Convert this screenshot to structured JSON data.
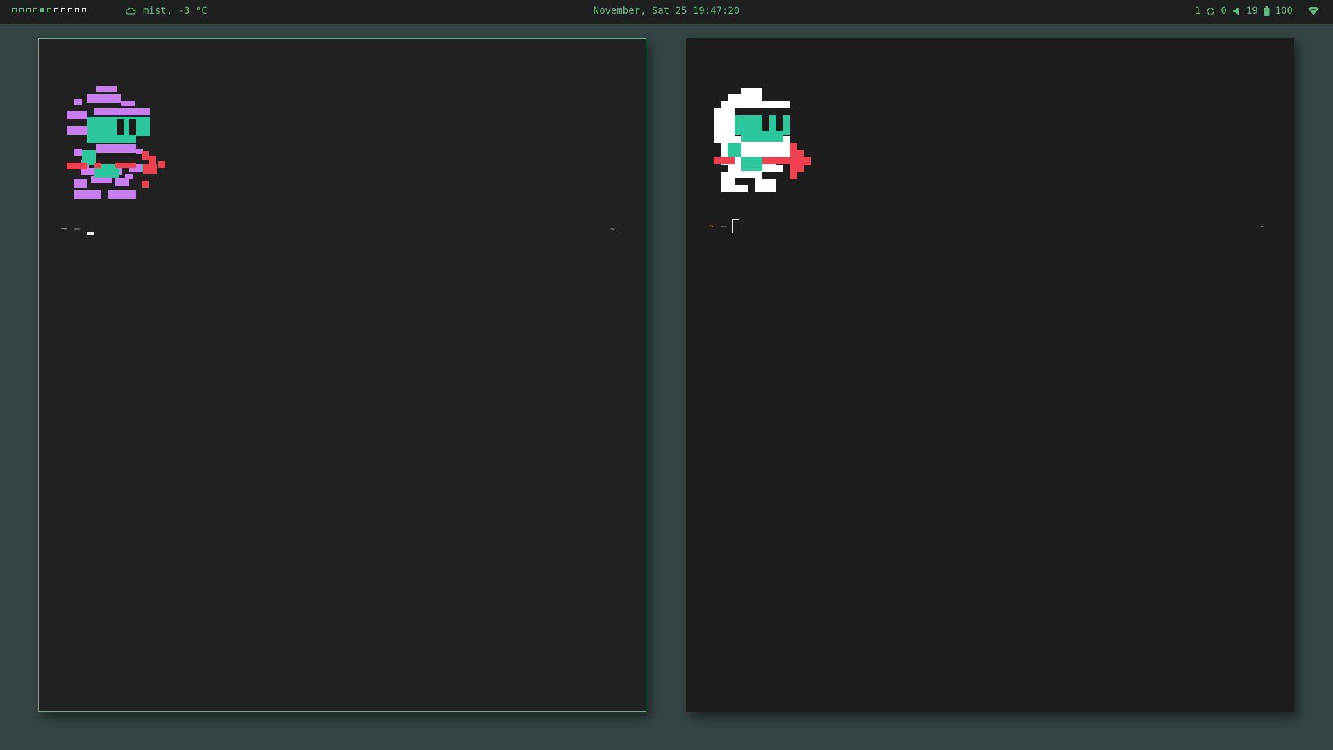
{
  "topbar": {
    "workspaces": [
      {
        "id": 1,
        "state": "empty"
      },
      {
        "id": 2,
        "state": "empty"
      },
      {
        "id": 3,
        "state": "empty"
      },
      {
        "id": 4,
        "state": "empty"
      },
      {
        "id": 5,
        "state": "active"
      },
      {
        "id": 6,
        "state": "empty"
      },
      {
        "id": 7,
        "state": "occupied"
      },
      {
        "id": 8,
        "state": "occupied"
      },
      {
        "id": 9,
        "state": "occupied"
      },
      {
        "id": 10,
        "state": "occupied"
      },
      {
        "id": 11,
        "state": "occupied"
      }
    ],
    "weather": {
      "icon": "cloud-icon",
      "text": "mist, -3 °C"
    },
    "clock": "November, Sat 25 19:47:20",
    "status": {
      "desktop": "1",
      "updates_icon": "refresh-icon",
      "updates": "0",
      "volume_icon": "speaker-icon",
      "volume": "19",
      "battery_icon": "battery-icon",
      "battery": "100",
      "wifi_icon": "wifi-icon"
    },
    "accent": "#62b981"
  },
  "terminals": [
    {
      "id": "left",
      "focused": true,
      "art": "pixel-knight-glitch",
      "prompt": {
        "tilde": "~",
        "dash": "–",
        "right": "~"
      }
    },
    {
      "id": "right",
      "focused": false,
      "art": "pixel-knight",
      "prompt": {
        "tilde": "~",
        "dash": "–",
        "right": "~"
      }
    }
  ],
  "colors": {
    "background": "#344344",
    "terminal_bg": "#212121",
    "knight_face": "#2cc79a",
    "knight_body_white": "#ffffff",
    "knight_body_glitch": "#c97df0",
    "spear": "#ef4050",
    "prompt_yellow": "#d6c75a"
  }
}
